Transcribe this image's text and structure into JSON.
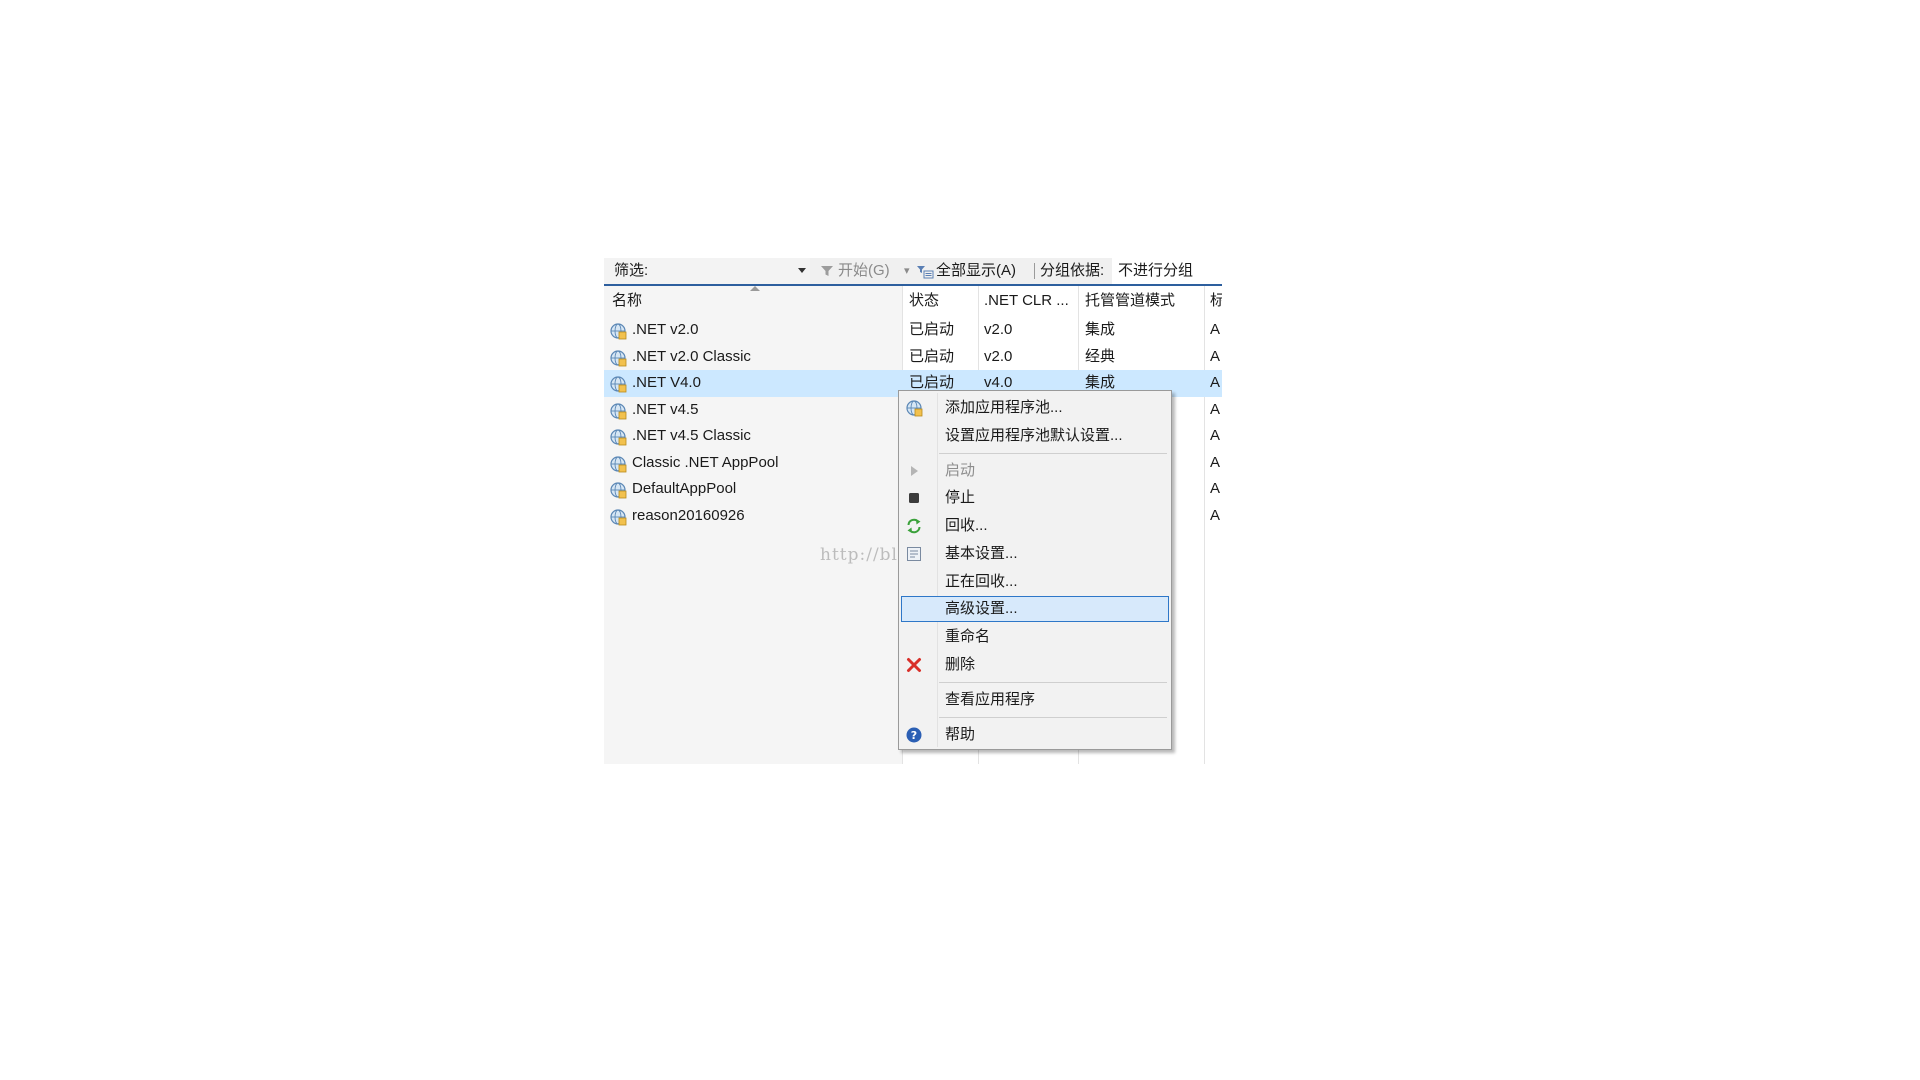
{
  "toolbar": {
    "filter_label": "筛选:",
    "start_label": "开始(G)",
    "show_all_label": "全部显示(A)",
    "group_by_label": "分组依据:",
    "group_by_value": "不进行分组"
  },
  "columns": [
    "名称",
    "状态",
    ".NET CLR ...",
    "托管管道模式",
    "标"
  ],
  "rows": [
    {
      "name": ".NET v2.0",
      "status": "已启动",
      "clr": "v2.0",
      "mode": "集成",
      "id": "A"
    },
    {
      "name": ".NET v2.0 Classic",
      "status": "已启动",
      "clr": "v2.0",
      "mode": "经典",
      "id": "A"
    },
    {
      "name": ".NET V4.0",
      "status": "已启动",
      "clr": "v4.0",
      "mode": "集成",
      "id": "A"
    },
    {
      "name": ".NET v4.5",
      "status": "",
      "clr": "",
      "mode": "",
      "id": "A"
    },
    {
      "name": ".NET v4.5 Classic",
      "status": "",
      "clr": "",
      "mode": "",
      "id": "A"
    },
    {
      "name": "Classic .NET AppPool",
      "status": "",
      "clr": "",
      "mode": "",
      "id": "A"
    },
    {
      "name": "DefaultAppPool",
      "status": "",
      "clr": "",
      "mode": "",
      "id": "A"
    },
    {
      "name": "reason20160926",
      "status": "",
      "clr": "",
      "mode": "",
      "id": "A"
    }
  ],
  "selected_row": 2,
  "context_menu": {
    "items": [
      {
        "label": "添加应用程序池...",
        "icon": "app-pool-icon"
      },
      {
        "label": "设置应用程序池默认设置...",
        "icon": ""
      },
      {
        "label": "启动",
        "icon": "play-icon",
        "disabled": true
      },
      {
        "label": "停止",
        "icon": "stop-icon"
      },
      {
        "label": "回收...",
        "icon": "recycle-icon"
      },
      {
        "label": "基本设置...",
        "icon": "settings-page-icon"
      },
      {
        "label": "正在回收...",
        "icon": ""
      },
      {
        "label": "高级设置...",
        "icon": "",
        "highlighted": true
      },
      {
        "label": "重命名",
        "icon": ""
      },
      {
        "label": "删除",
        "icon": "delete-icon"
      },
      {
        "label": "查看应用程序",
        "icon": ""
      },
      {
        "label": "帮助",
        "icon": "help-icon"
      }
    ]
  },
  "watermark": "http://blog.csdn.net/dujiajiyiyi",
  "colors": {
    "selection": "#cce8ff",
    "highlight_border": "#2e77c8",
    "delete_red": "#d9302a",
    "recycle_green": "#3aa13a",
    "help_blue": "#2b5fb4"
  }
}
